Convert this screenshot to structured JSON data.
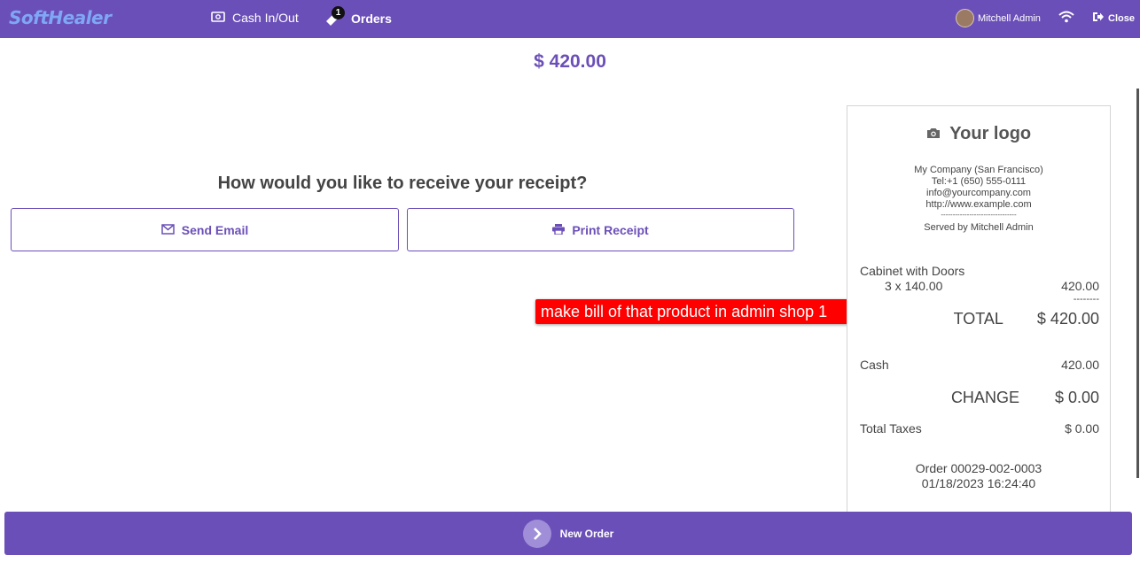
{
  "header": {
    "logo": "SoftHealer",
    "cash_label": "Cash In/Out",
    "orders_label": "Orders",
    "orders_badge": "1",
    "user_name": "Mitchell Admin",
    "close_label": "Close"
  },
  "payment": {
    "amount": "$ 420.00"
  },
  "receipt_prompt": {
    "question": "How would you like to receive your receipt?",
    "send_email_label": "Send Email",
    "print_receipt_label": "Print Receipt"
  },
  "annotation": "make  bill of that product in admin shop 1",
  "receipt": {
    "logo_text": "Your logo",
    "company": "My Company (San Francisco)",
    "tel": "Tel:+1 (650) 555-0111",
    "email": "info@yourcompany.com",
    "website": "http://www.example.com",
    "separator": "--------------------------------",
    "served_by": "Served by Mitchell Admin",
    "line_product": "Cabinet with Doors",
    "line_qty": "3 x 140.00",
    "line_total": "420.00",
    "dashes": "--------",
    "total_label": "TOTAL",
    "total_value": "$ 420.00",
    "payment_method": "Cash",
    "payment_value": "420.00",
    "change_label": "CHANGE",
    "change_value": "$ 0.00",
    "taxes_label": "Total Taxes",
    "taxes_value": "$ 0.00",
    "order_ref": "Order 00029-002-0003",
    "order_date": "01/18/2023 16:24:40"
  },
  "footer": {
    "new_order_label": "New Order"
  },
  "colors": {
    "brand": "#6b4fb8",
    "annotation": "#ff0000"
  }
}
